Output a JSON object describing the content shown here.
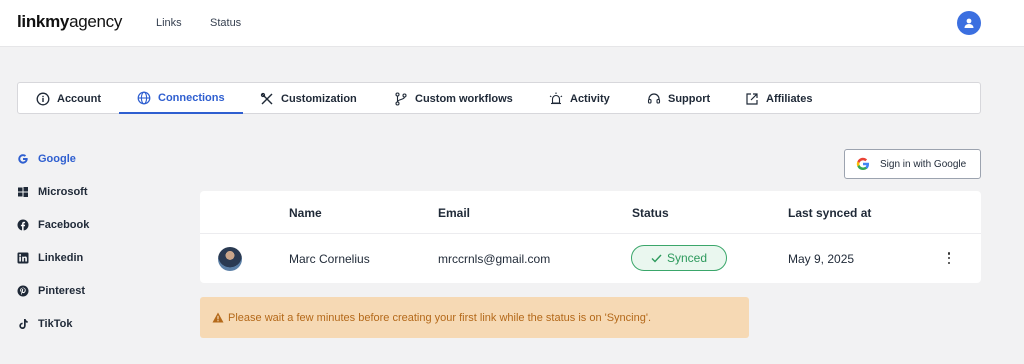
{
  "header": {
    "logo_bold": "linkmy",
    "logo_regular": "agency",
    "nav": [
      "Links",
      "Status"
    ],
    "avatar_color": "#3b6fe0"
  },
  "tabs": [
    {
      "label": "Account",
      "icon": "info-icon"
    },
    {
      "label": "Connections",
      "icon": "globe-icon",
      "active": true
    },
    {
      "label": "Customization",
      "icon": "tools-icon"
    },
    {
      "label": "Custom workflows",
      "icon": "branch-icon"
    },
    {
      "label": "Activity",
      "icon": "alarm-icon"
    },
    {
      "label": "Support",
      "icon": "headset-icon"
    },
    {
      "label": "Affiliates",
      "icon": "external-link-icon"
    }
  ],
  "sidebar": [
    {
      "label": "Google",
      "icon": "google-icon",
      "active": true
    },
    {
      "label": "Microsoft",
      "icon": "windows-icon"
    },
    {
      "label": "Facebook",
      "icon": "facebook-icon"
    },
    {
      "label": "Linkedin",
      "icon": "linkedin-icon"
    },
    {
      "label": "Pinterest",
      "icon": "pinterest-icon"
    },
    {
      "label": "TikTok",
      "icon": "tiktok-icon"
    }
  ],
  "google_button": {
    "label": "Sign in with Google"
  },
  "table": {
    "headers": [
      "Name",
      "Email",
      "Status",
      "Last synced at"
    ],
    "rows": [
      {
        "name": "Marc Cornelius",
        "email": "mrccrnls@gmail.com",
        "status": "Synced",
        "last_synced": "May 9, 2025"
      }
    ]
  },
  "warning": {
    "text": "Please wait a few minutes before creating your first link while the status is on 'Syncing'."
  },
  "colors": {
    "accent": "#2f5fd0",
    "success": "#2e9a5d",
    "warning_bg": "#f6d9b4",
    "warning_text": "#b4691a"
  }
}
